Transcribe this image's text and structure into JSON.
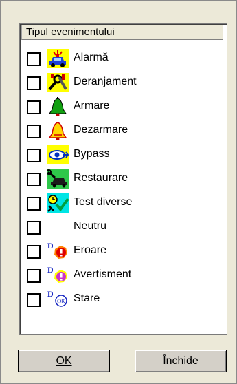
{
  "list": {
    "header": "Tipul evenimentului",
    "items": [
      {
        "label": "Alarmă",
        "icon": "alarm-car-icon"
      },
      {
        "label": "Deranjament",
        "icon": "fault-tools-icon"
      },
      {
        "label": "Armare",
        "icon": "arm-bell-icon"
      },
      {
        "label": "Dezarmare",
        "icon": "disarm-bell-icon"
      },
      {
        "label": "Bypass",
        "icon": "bypass-eye-icon"
      },
      {
        "label": "Restaurare",
        "icon": "restore-car-icon"
      },
      {
        "label": "Test diverse",
        "icon": "test-check-icon"
      },
      {
        "label": "Neutru",
        "icon": ""
      },
      {
        "label": "Eroare",
        "icon": "error-d-icon"
      },
      {
        "label": "Avertisment",
        "icon": "warning-d-icon"
      },
      {
        "label": "Stare",
        "icon": "status-d-ok-icon"
      }
    ]
  },
  "buttons": {
    "ok": "OK",
    "close": "Închide"
  }
}
